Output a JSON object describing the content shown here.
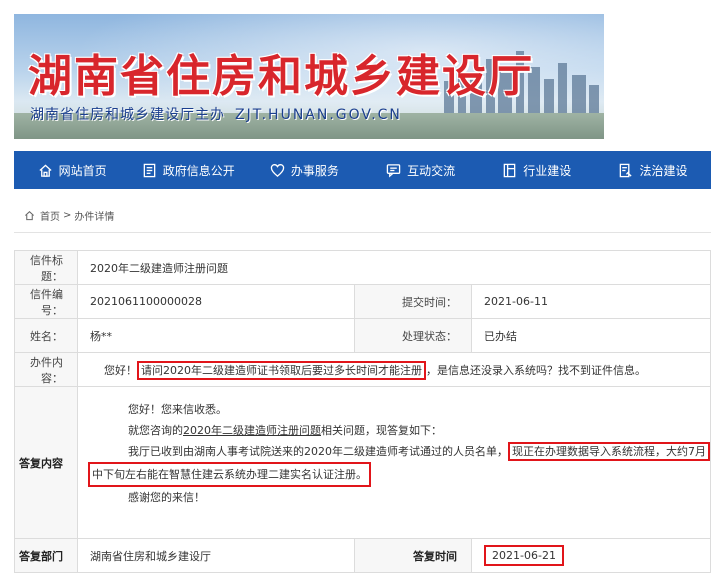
{
  "header": {
    "title": "湖南省住房和城乡建设厅",
    "subtitle": "湖南省住房和城乡建设厅主办",
    "url": "ZJT.HUNAN.GOV.CN"
  },
  "nav": {
    "items": [
      {
        "label": "网站首页",
        "icon": "home-icon"
      },
      {
        "label": "政府信息公开",
        "icon": "document-icon"
      },
      {
        "label": "办事服务",
        "icon": "heart-icon"
      },
      {
        "label": "互动交流",
        "icon": "chat-icon"
      },
      {
        "label": "行业建设",
        "icon": "building-icon"
      },
      {
        "label": "法治建设",
        "icon": "law-icon"
      }
    ]
  },
  "breadcrumb": {
    "home": "首页",
    "separator": ">",
    "current": "办件详情"
  },
  "letter": {
    "title_label": "信件标题：",
    "title": "2020年二级建造师注册问题",
    "number_label": "信件编号：",
    "number": "2021061100000028",
    "submit_label": "提交时间：",
    "submit_time": "2021-06-11",
    "name_label": "姓名：",
    "name": "杨**",
    "status_label": "处理状态：",
    "status": "已办结",
    "content_label": "办件内容：",
    "content_prefix": "您好！",
    "content_highlight": "请问2020年二级建造师证书领取后要过多长时间才能注册",
    "content_suffix": "，是信息还没录入系统吗？找不到证件信息。"
  },
  "reply": {
    "label": "答复内容",
    "greeting": "您好！您来信收悉。",
    "line2_prefix": "就您咨询的",
    "line2_underlined": "2020年二级建造师注册问题",
    "line2_suffix": "相关问题，现答复如下：",
    "line3_prefix": "我厅已收到由湖南人事考试院送来的2020年二级建造师考试通过的人员名单，",
    "line3_highlight": "现正在办理数据导入系统流程，大约7月",
    "line4_highlight": "中下旬左右能在智慧住建云系统办理二建实名认证注册。",
    "closing": "感谢您的来信！",
    "dept_label": "答复部门",
    "dept": "湖南省住房和城乡建设厅",
    "time_label": "答复时间",
    "time": "2021-06-21"
  },
  "colors": {
    "nav_bg": "#1c5bb2",
    "title_red": "#d8262c",
    "highlight_red": "#e1151a"
  }
}
